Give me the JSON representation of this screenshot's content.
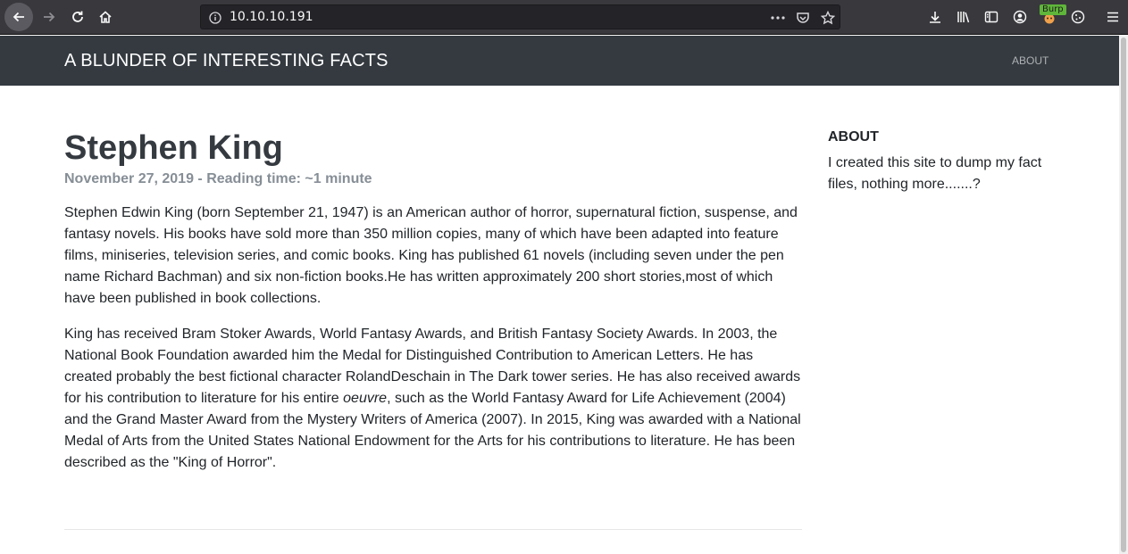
{
  "browser": {
    "url": "10.10.10.191",
    "burp_badge": "Burp",
    "icons": [
      "back-icon",
      "forward-icon",
      "reload-icon",
      "home-icon",
      "info-icon",
      "more-icon",
      "pocket-icon",
      "star-icon",
      "download-icon",
      "library-icon",
      "sidebar-icon",
      "account-icon",
      "burp-icon",
      "cookie-icon",
      "menu-icon"
    ]
  },
  "site": {
    "brand": "A BLUNDER OF INTERESTING FACTS",
    "nav_about": "ABOUT"
  },
  "post": {
    "title": "Stephen King",
    "meta": "November 27, 2019 - Reading time: ~1 minute",
    "paragraph1": "Stephen Edwin King (born September 21, 1947) is an American author of horror, supernatural fiction, suspense, and fantasy novels. His books have sold more than 350 million copies, many of which have been adapted into feature films, miniseries, television series, and comic books. King has published 61 novels (including seven under the pen name Richard Bachman) and six non-fiction books.He has written approximately 200 short stories,most of which have been published in book collections.",
    "paragraph2_before": "King has received Bram Stoker Awards, World Fantasy Awards, and British Fantasy Society Awards. In 2003, the National Book Foundation awarded him the Medal for Distinguished Contribution to American Letters. He has created probably the best fictional character RolandDeschain in The Dark tower series. He has also received awards for his contribution to literature for his entire ",
    "paragraph2_em": "oeuvre",
    "paragraph2_after": ", such as the World Fantasy Award for Life Achievement (2004) and the Grand Master Award from the Mystery Writers of America (2007). In 2015, King was awarded with a National Medal of Arts from the United States National Endowment for the Arts for his contributions to literature. He has been described as the \"King of Horror\"."
  },
  "sidebar": {
    "title": "ABOUT",
    "text": "I created this site to dump my fact files, nothing more.......?"
  }
}
